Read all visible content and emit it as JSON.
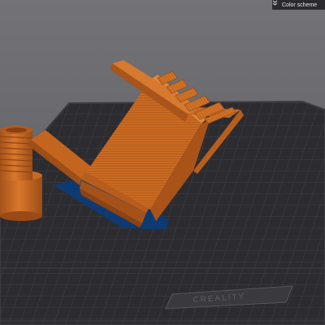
{
  "toolbar": {
    "color_scheme_label": "Color scheme",
    "color_scheme_icon": "double-chevron-down-icon"
  },
  "build_plate": {
    "brand_logo_text": "CREALITY"
  },
  "colors": {
    "viewport_background": "#6a6a6f",
    "build_plate": "#2c2c30",
    "model_orange": "#c96a22",
    "model_shadow": "#0e3a73",
    "toolbar_background": "#2b2b2f"
  }
}
